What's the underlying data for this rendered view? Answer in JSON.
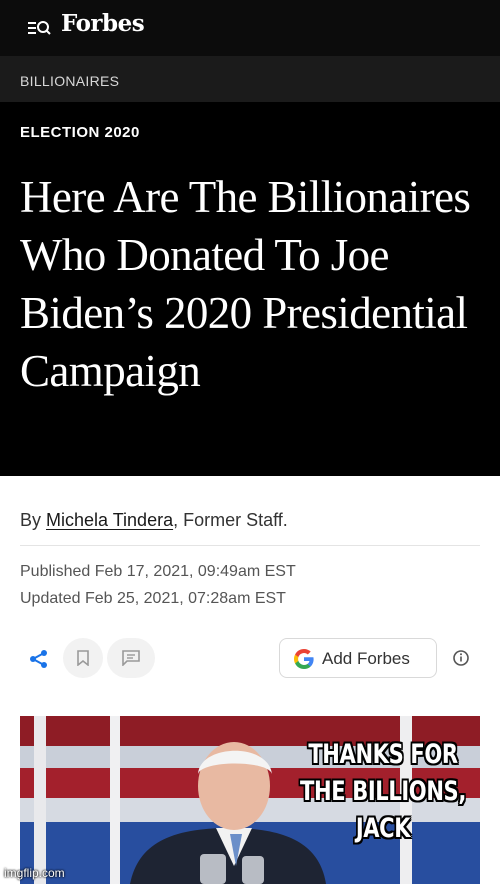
{
  "header": {
    "brand": "Forbes",
    "menu_icon": "menu-search-icon",
    "background": "#0c0c0c"
  },
  "section": {
    "label": "BILLIONAIRES"
  },
  "article": {
    "kicker": "ELECTION 2020",
    "headline": "Here Are The Billionaires Who Donated To Joe Biden’s 2020 Presidential Campaign",
    "byline_prefix": "By ",
    "author": "Michela Tindera",
    "byline_suffix": ", Former Staff.",
    "published": "Published Feb 17, 2021, 09:49am EST",
    "updated": "Updated Feb 25, 2021, 07:28am EST"
  },
  "actions": {
    "share_icon": "share-icon",
    "bookmark_icon": "bookmark-icon",
    "comment_icon": "comment-icon",
    "add_source_label": "Add Forbes",
    "google_icon": "google-g-icon",
    "info_icon": "info-icon"
  },
  "meme": {
    "caption": "THANKS FOR THE BILLIONS, JACK",
    "watermark": "imgflip.com"
  },
  "colors": {
    "accent_blue": "#1a73e8",
    "google_blue": "#4285F4",
    "google_red": "#EA4335",
    "google_yellow": "#FBBC05",
    "google_green": "#34A853"
  }
}
